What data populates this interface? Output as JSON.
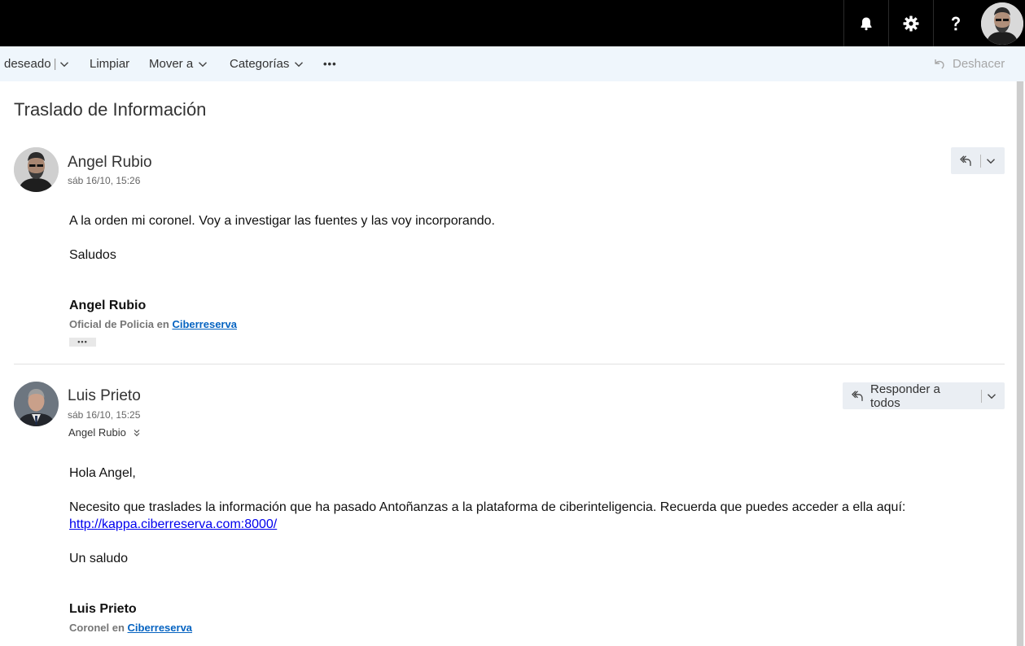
{
  "topbar": {
    "buttons": [
      {
        "name": "bell-icon"
      },
      {
        "name": "gear-icon"
      },
      {
        "name": "help-icon"
      }
    ],
    "colors": {
      "background": "#000000",
      "icon": "#ffffff"
    }
  },
  "toolbar": {
    "filter_label": "deseado",
    "clean_label": "Limpiar",
    "move_label": "Mover a",
    "categories_label": "Categorías",
    "more_label": "•••",
    "undo_label": "Deshacer"
  },
  "conversation": {
    "subject": "Traslado de Información",
    "messages": [
      {
        "sender": "Angel Rubio",
        "date": "sáb 16/10, 15:26",
        "body": [
          "A la orden mi coronel. Voy a investigar las fuentes y las voy incorporando.",
          "Saludos"
        ],
        "signature": {
          "name": "Angel Rubio",
          "role_prefix": "Oficial de Policia en",
          "org_link": "Ciberreserva"
        },
        "ellipsis": "•••"
      },
      {
        "sender": "Luis Prieto",
        "date": "sáb 16/10, 15:25",
        "to": "Angel Rubio",
        "reply_label": "Responder a todos",
        "body": [
          "Hola Angel,",
          "Necesito que traslades la información que ha pasado Antoñanzas a la plataforma de ciberinteligencia. Recuerda que puedes acceder a ella aquí:",
          "Un saludo"
        ],
        "link": "http://kappa.ciberreserva.com:8000/",
        "signature": {
          "name": "Luis Prieto",
          "role_prefix": "Coronel en",
          "org_link": "Ciberreserva"
        }
      }
    ]
  },
  "colors": {
    "command_bar_bg": "#eff6fc",
    "link": "#0563c1",
    "reply_button_bg": "#eaeef3"
  }
}
